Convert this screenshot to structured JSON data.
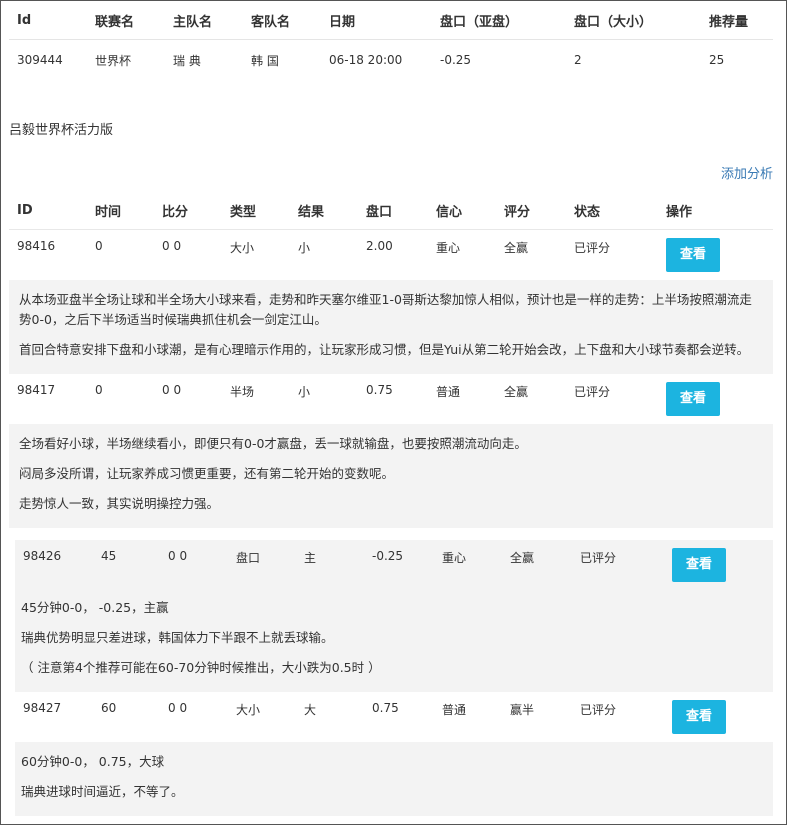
{
  "match": {
    "headers": [
      "Id",
      "联赛名",
      "主队名",
      "客队名",
      "日期",
      "盘口（亚盘）",
      "盘口（大小）",
      "推荐量"
    ],
    "row": [
      "309444",
      "世界杯",
      "瑞 典",
      "韩 国",
      "06-18 20:00",
      "-0.25",
      "2",
      "25"
    ]
  },
  "author": "吕毅世界杯活力版",
  "add_analysis": "添加分析",
  "analysis_headers": [
    "ID",
    "时间",
    "比分",
    "类型",
    "结果",
    "盘口",
    "信心",
    "评分",
    "状态",
    "操作"
  ],
  "analyses": [
    {
      "cells": [
        "98416",
        "0",
        "0 0",
        "大小",
        "小",
        "2.00",
        "重心",
        "全赢",
        "已评分"
      ],
      "button": "查看",
      "text": [
        "从本场亚盘半全场让球和半全场大小球来看，走势和昨天塞尔维亚1-0哥斯达黎加惊人相似，预计也是一样的走势：上半场按照潮流走势0-0，之后下半场适当时候瑞典抓住机会一剑定江山。",
        "首回合特意安排下盘和小球潮，是有心理暗示作用的，让玩家形成习惯，但是Yui从第二轮开始会改，上下盘和大小球节奏都会逆转。"
      ]
    },
    {
      "cells": [
        "98417",
        "0",
        "0 0",
        "半场",
        "小",
        "0.75",
        "普通",
        "全赢",
        "已评分"
      ],
      "button": "查看",
      "text": [
        "全场看好小球，半场继续看小，即便只有0-0才赢盘，丢一球就输盘，也要按照潮流动向走。",
        "闷局多没所谓，让玩家养成习惯更重要，还有第二轮开始的变数呢。",
        "走势惊人一致，其实说明操控力强。"
      ]
    },
    {
      "cells": [
        "98426",
        "45",
        "0 0",
        "盘口",
        "主",
        "-0.25",
        "重心",
        "全赢",
        "已评分"
      ],
      "button": "查看",
      "text": [
        "45分钟0-0， -0.25，主赢",
        "瑞典优势明显只差进球，韩国体力下半跟不上就丢球输。",
        "（ 注意第4个推荐可能在60-70分钟时候推出，大小跌为0.5时 ）"
      ]
    },
    {
      "cells": [
        "98427",
        "60",
        "0 0",
        "大小",
        "大",
        "0.75",
        "普通",
        "赢半",
        "已评分"
      ],
      "button": "查看",
      "text": [
        "60分钟0-0， 0.75，大球",
        "瑞典进球时间逼近，不等了。"
      ]
    }
  ]
}
